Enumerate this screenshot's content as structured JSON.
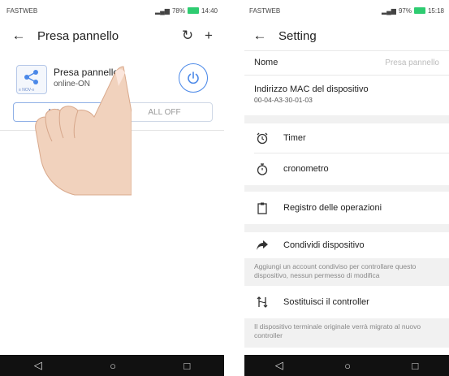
{
  "left": {
    "status": {
      "carrier": "FASTWEB",
      "signal": "½½ ⋈ ≡ .▪78%",
      "battery_pct": "78%",
      "time": "14:40"
    },
    "title": "Presa pannello",
    "device": {
      "name": "Presa pannello",
      "status": "online-ON",
      "icon_label": "≡ NOV-≡"
    },
    "buttons": {
      "on": "ALL ON",
      "off": "ALL OFF"
    }
  },
  "right": {
    "status": {
      "carrier": "FASTWEB",
      "signal": "½½ ⋈ ≡ .▪97%",
      "battery_pct": "97%",
      "time": "15:18"
    },
    "title": "Setting",
    "nome_label": "Nome",
    "nome_value": "Presa pannello",
    "mac_label": "Indirizzo MAC del dispositivo",
    "mac_value": "00-04-A3-30-01-03",
    "items": {
      "timer": "Timer",
      "cronometro": "cronometro",
      "registro": "Registro delle operazioni",
      "condividi": "Condividi dispositivo",
      "sostituisci": "Sostituisci il controller"
    },
    "hint_share": "Aggiungi un account condiviso per controllare questo dispositivo, nessun permesso di modifica",
    "hint_replace": "Il dispositivo terminale originale verrà migrato al nuovo controller"
  },
  "colors": {
    "accent": "#4a88e8",
    "battery": "#2ecc71"
  }
}
